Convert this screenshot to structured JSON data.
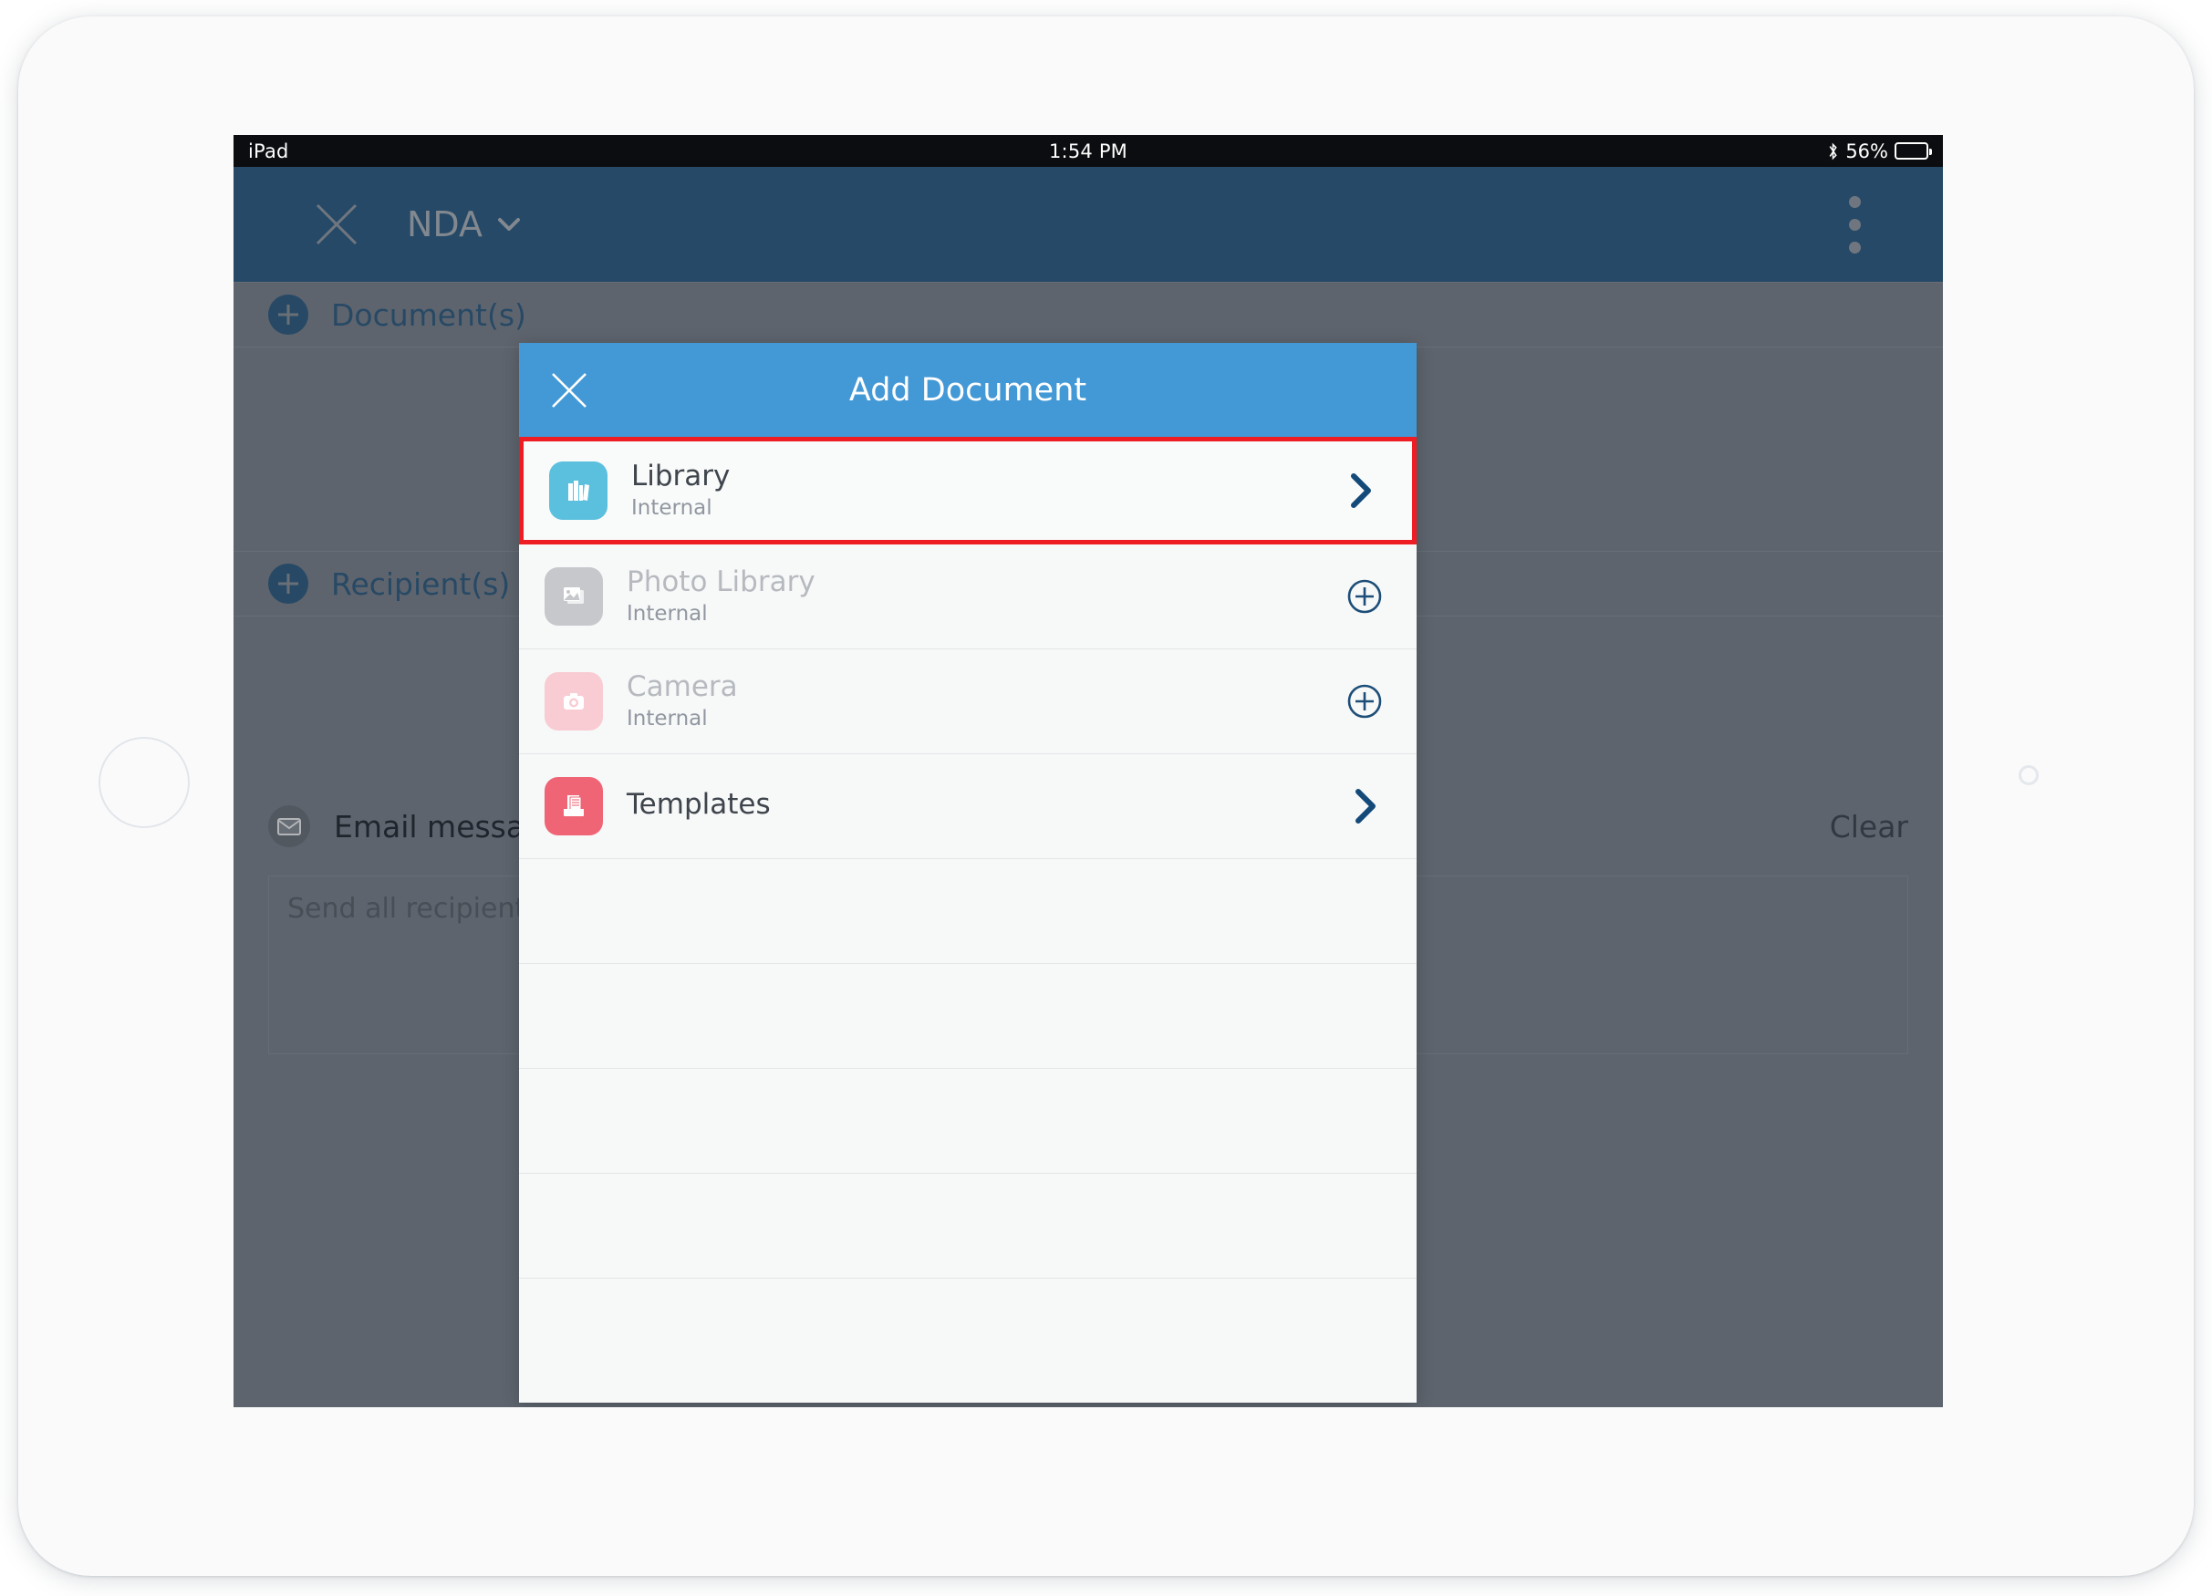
{
  "status_bar": {
    "device_label": "iPad",
    "time": "1:54 PM",
    "bluetooth_icon": "bluetooth-icon",
    "battery_percent": "56%",
    "battery_icon": "battery-icon",
    "battery_level": 56
  },
  "app_navbar": {
    "close_icon": "close-x-icon",
    "title": "NDA",
    "chevron_icon": "chevron-down-icon",
    "more_icon": "more-vertical-icon",
    "background_color": "#2a5d85"
  },
  "app_body": {
    "documents_section": {
      "label": "Document(s)",
      "add_icon": "plus-circle-icon"
    },
    "recipients_section": {
      "label": "Recipient(s)",
      "add_icon": "plus-circle-icon"
    },
    "email": {
      "label": "Email message",
      "envelope_icon": "envelope-icon",
      "clear_label": "Clear",
      "message_placeholder": "Send all recipients a message",
      "message_value": ""
    }
  },
  "dialog": {
    "title": "Add Document",
    "close_icon": "close-x-icon",
    "header_color": "#4398d6",
    "highlight_color": "#ee1d24",
    "accent_chevron_color": "#134a7a",
    "rows": [
      {
        "title": "Library",
        "subtitle": "Internal",
        "icon": "books-icon",
        "icon_color": "#5bc0de",
        "action_icon": "chevron-right-icon",
        "enabled": true,
        "highlighted": true
      },
      {
        "title": "Photo Library",
        "subtitle": "Internal",
        "icon": "photo-icon",
        "icon_color": "#c6c8cc",
        "action_icon": "plus-circle-outline-icon",
        "enabled": false,
        "highlighted": false
      },
      {
        "title": "Camera",
        "subtitle": "Internal",
        "icon": "camera-icon",
        "icon_color": "#f8ccd2",
        "action_icon": "plus-circle-outline-icon",
        "enabled": false,
        "highlighted": false
      },
      {
        "title": "Templates",
        "subtitle": "",
        "icon": "template-tray-icon",
        "icon_color": "#ef6575",
        "action_icon": "chevron-right-icon",
        "enabled": true,
        "highlighted": false
      }
    ],
    "empty_row_count": 5
  }
}
